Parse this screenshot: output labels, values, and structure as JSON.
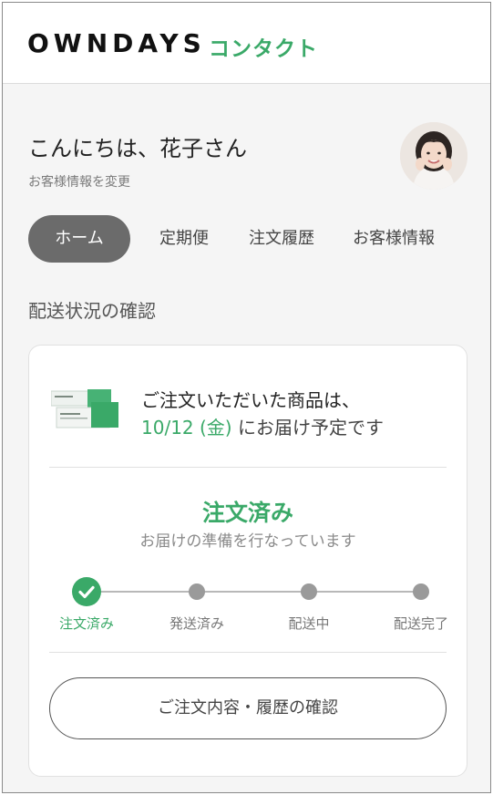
{
  "header": {
    "logo": "OWNDAYS",
    "logo_sub": "コンタクト"
  },
  "user": {
    "greeting": "こんにちは、花子さん",
    "profile_link": "お客様情報を変更",
    "avatar_icon": "avatar-photo"
  },
  "tabs": [
    {
      "label": "ホーム",
      "active": true
    },
    {
      "label": "定期便",
      "active": false
    },
    {
      "label": "注文履歴",
      "active": false
    },
    {
      "label": "お客様情報",
      "active": false
    }
  ],
  "delivery": {
    "section_title": "配送状況の確認",
    "message_line1": "ご注文いただいた商品は、",
    "message_date": "10/12 (金)",
    "message_line2_rest": " にお届け予定です",
    "status_title": "注文済み",
    "status_sub": "お届けの準備を行なっています",
    "steps": [
      {
        "label": "注文済み",
        "done": true
      },
      {
        "label": "発送済み",
        "done": false
      },
      {
        "label": "配送中",
        "done": false
      },
      {
        "label": "配送完了",
        "done": false
      }
    ],
    "history_button": "ご注文内容・履歴の確認"
  },
  "colors": {
    "accent": "#3aa968",
    "tab_active_bg": "#6b6b6b",
    "background": "#f5f5f5"
  }
}
